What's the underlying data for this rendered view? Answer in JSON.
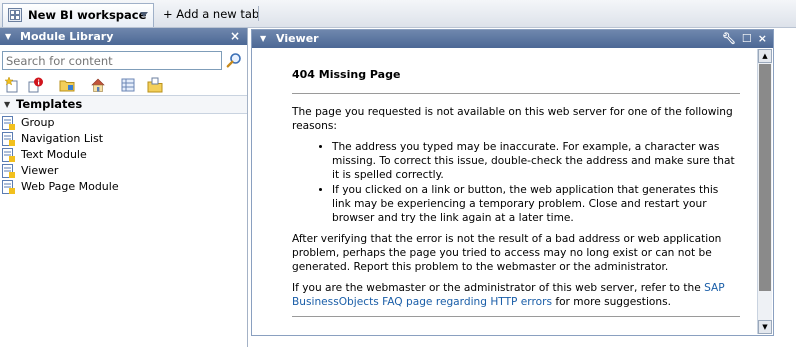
{
  "tabs": {
    "active_label": "New BI workspace",
    "add_label": "+ Add a new tab"
  },
  "module_library": {
    "title": "Module Library",
    "search_placeholder": "Search for content",
    "templates_header": "Templates",
    "items": [
      {
        "label": "Group"
      },
      {
        "label": "Navigation List"
      },
      {
        "label": "Text Module"
      },
      {
        "label": "Viewer"
      },
      {
        "label": "Web Page Module"
      }
    ]
  },
  "viewer": {
    "title": "Viewer",
    "page": {
      "heading": "404 Missing Page",
      "intro": "The page you requested is not available on this web server for one of the following reasons:",
      "bullets": [
        "The address you typed may be inaccurate. For example, a character was missing. To correct this issue, double-check the address and make sure that it is spelled correctly.",
        "If you clicked on a link or button, the web application that generates this link may be experiencing a temporary problem. Close and restart your browser and try the link again at a later time."
      ],
      "after": "After verifying that the error is not the result of a bad address or web application problem, perhaps the page you tried to access may no long exist or can not be generated. Report this problem to the webmaster or the administrator.",
      "admin_prefix": "If you are the webmaster or the administrator of this web server, refer to the ",
      "admin_link": "SAP BusinessObjects FAQ page regarding HTTP errors",
      "admin_suffix": " for more suggestions."
    }
  },
  "colors": {
    "title_bar": "#4c6895",
    "link": "#1a5ea8",
    "scroll_thumb": "#8a8a8a"
  }
}
